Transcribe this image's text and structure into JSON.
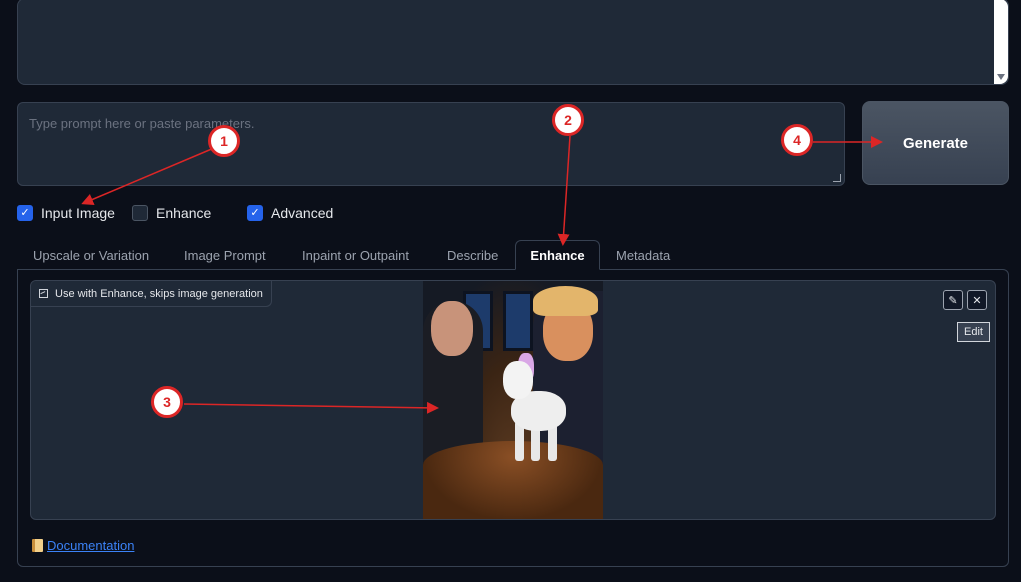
{
  "prompt": {
    "placeholder": "Type prompt here or paste parameters."
  },
  "generate_button": "Generate",
  "checkboxes": [
    {
      "label": "Input Image",
      "checked": true
    },
    {
      "label": "Enhance",
      "checked": false
    },
    {
      "label": "Advanced",
      "checked": true
    }
  ],
  "tabs": [
    {
      "label": "Upscale or Variation",
      "active": false
    },
    {
      "label": "Image Prompt",
      "active": false
    },
    {
      "label": "Inpaint or Outpaint",
      "active": false
    },
    {
      "label": "Describe",
      "active": false
    },
    {
      "label": "Enhance",
      "active": true
    },
    {
      "label": "Metadata",
      "active": false
    }
  ],
  "image_panel": {
    "label": "Use with Enhance, skips image generation",
    "edit_icon": "pencil-icon",
    "close_icon": "close-icon",
    "tooltip": "Edit"
  },
  "documentation_link": "Documentation",
  "callouts": [
    "1",
    "2",
    "3",
    "4"
  ],
  "colors": {
    "accent": "#2563eb",
    "callout": "#dc2626",
    "background": "#0b0f19",
    "panel": "#1f2937"
  }
}
